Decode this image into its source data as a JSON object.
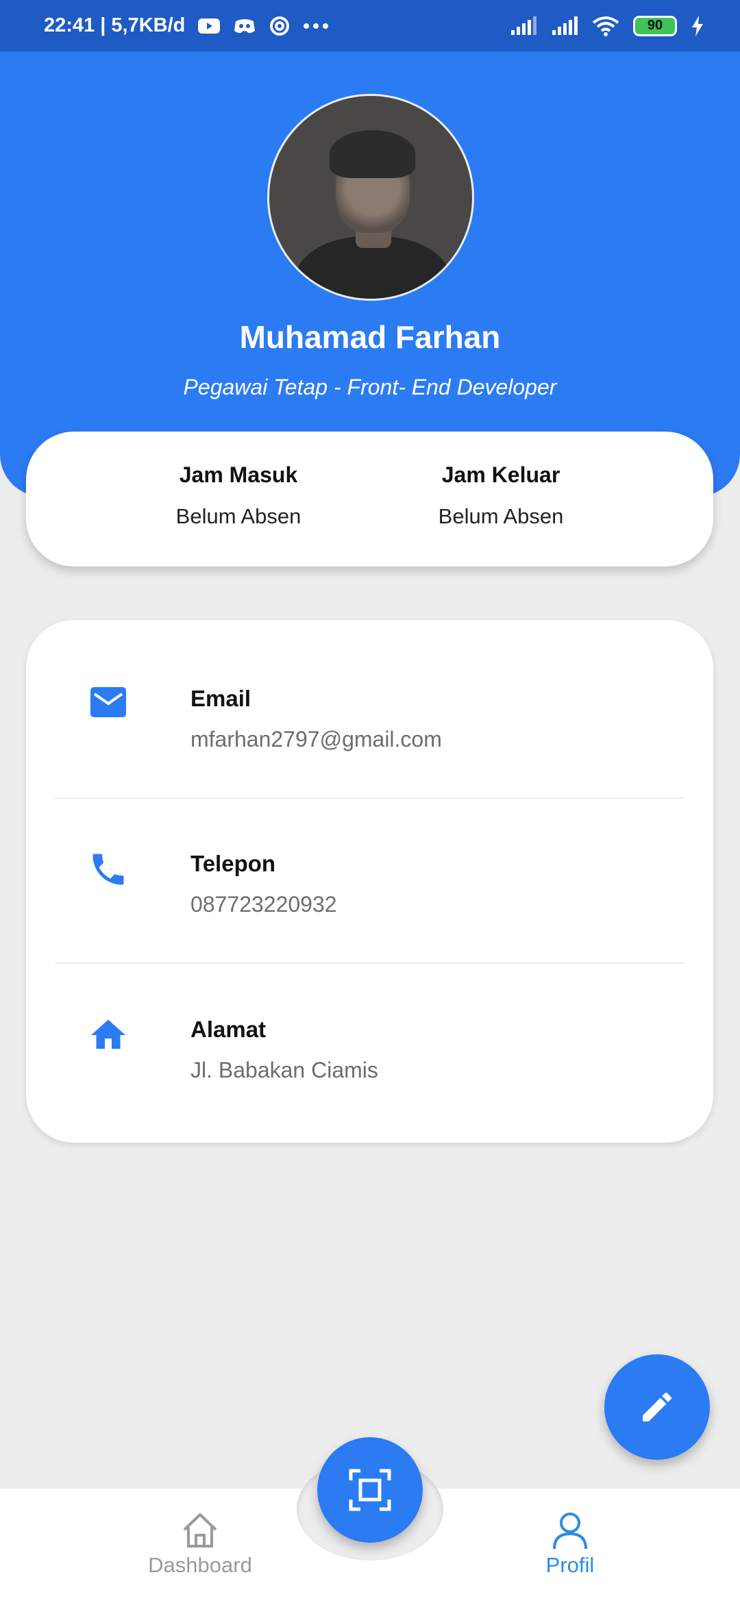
{
  "status_bar": {
    "time_speed": "22:41 | 5,7KB/d",
    "battery": "90"
  },
  "profile": {
    "name": "Muhamad Farhan",
    "role": "Pegawai Tetap - Front- End Developer"
  },
  "attendance": {
    "check_in": {
      "label": "Jam Masuk",
      "value": "Belum Absen"
    },
    "check_out": {
      "label": "Jam Keluar",
      "value": "Belum Absen"
    }
  },
  "info": [
    {
      "label": "Email",
      "value": "mfarhan2797@gmail.com",
      "icon": "mail-icon"
    },
    {
      "label": "Telepon",
      "value": "087723220932",
      "icon": "phone-icon"
    },
    {
      "label": "Alamat",
      "value": "Jl. Babakan Ciamis",
      "icon": "home-icon"
    }
  ],
  "bottom_nav": {
    "dashboard": "Dashboard",
    "profil": "Profil",
    "active": "profil"
  },
  "colors": {
    "primary": "#2b7bf3",
    "status_bar": "#1f5bc4",
    "background": "#ededed",
    "active_nav": "#2b8be8"
  }
}
